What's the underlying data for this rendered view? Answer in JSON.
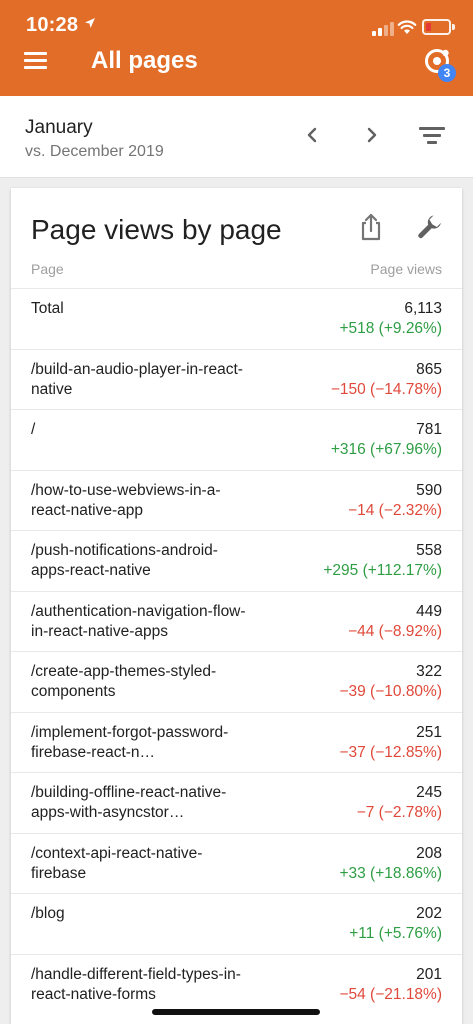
{
  "status_bar": {
    "time": "10:28"
  },
  "header": {
    "title": "All pages",
    "notification_count": "3"
  },
  "date_range": {
    "month": "January",
    "comparison": "vs. December 2019"
  },
  "card": {
    "title": "Page views by page",
    "col_page": "Page",
    "col_views": "Page views",
    "rows": [
      {
        "label": "Total",
        "value": "6,113",
        "delta": "+518 (+9.26%)",
        "trend": "pos"
      },
      {
        "label": "/build-an-audio-player-in-react-native",
        "value": "865",
        "delta": "−150 (−14.78%)",
        "trend": "neg"
      },
      {
        "label": "/",
        "value": "781",
        "delta": "+316 (+67.96%)",
        "trend": "pos"
      },
      {
        "label": "/how-to-use-webviews-in-a-react-native-app",
        "value": "590",
        "delta": "−14 (−2.32%)",
        "trend": "neg"
      },
      {
        "label": "/push-notifications-android-apps-react-native",
        "value": "558",
        "delta": "+295 (+112.17%)",
        "trend": "pos"
      },
      {
        "label": "/authentication-navigation-flow-in-react-native-apps",
        "value": "449",
        "delta": "−44 (−8.92%)",
        "trend": "neg"
      },
      {
        "label": "/create-app-themes-styled-components",
        "value": "322",
        "delta": "−39 (−10.80%)",
        "trend": "neg"
      },
      {
        "label": "/implement-forgot-password-firebase-react-n…",
        "value": "251",
        "delta": "−37 (−12.85%)",
        "trend": "neg"
      },
      {
        "label": "/building-offline-react-native-apps-with-asyncstor…",
        "value": "245",
        "delta": "−7 (−2.78%)",
        "trend": "neg"
      },
      {
        "label": "/context-api-react-native-firebase",
        "value": "208",
        "delta": "+33 (+18.86%)",
        "trend": "pos"
      },
      {
        "label": "/blog",
        "value": "202",
        "delta": "+11 (+5.76%)",
        "trend": "pos"
      },
      {
        "label": "/handle-different-field-types-in-react-native-forms",
        "value": "201",
        "delta": "−54 (−21.18%)",
        "trend": "neg"
      }
    ]
  },
  "colors": {
    "app_bar": "#e26d28",
    "positive": "#2e9e44",
    "negative": "#e0493a",
    "badge": "#4285f4"
  },
  "icons": [
    "location-arrow-icon",
    "signal-icon",
    "wifi-icon",
    "battery-icon",
    "menu-icon",
    "account-icon",
    "chevron-left-icon",
    "chevron-right-icon",
    "filter-icon",
    "share-icon",
    "wrench-icon"
  ]
}
